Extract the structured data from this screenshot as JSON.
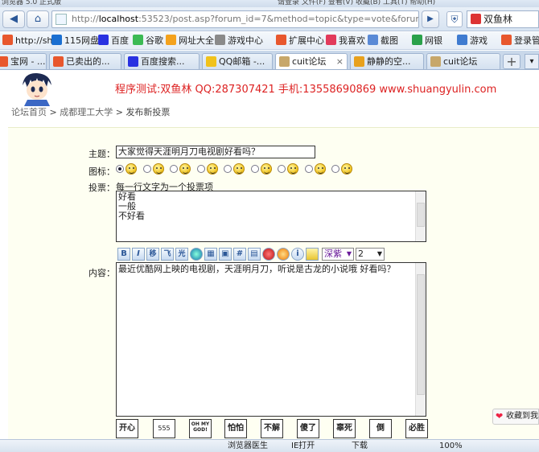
{
  "browser": {
    "title_left": "浏览器 5.0 正式版",
    "title_right": "请登录   文件(F)  查看(V)  收藏(B)  工具(T)  帮助(H)",
    "address_prefix": "http://",
    "address_host": "localhost",
    "address_rest": ":53523/post.asp?forum_id=7&method=topic&type=vote&forum_title",
    "search_value": "双鱼林"
  },
  "bookmarks": [
    {
      "label": "http://sh",
      "color": "#e8572d"
    },
    {
      "label": "115网盘",
      "color": "#1b6fd1"
    },
    {
      "label": "百度",
      "color": "#2932e1"
    },
    {
      "label": "谷歌",
      "color": "#3cba54"
    },
    {
      "label": "网址大全",
      "color": "#f4a21d"
    },
    {
      "label": "游戏中心",
      "color": "#8a8a8a"
    },
    {
      "label": "扩展中心",
      "color": "#e8572d"
    },
    {
      "label": "我喜欢",
      "color": "#e23a5b"
    },
    {
      "label": "截图",
      "color": "#5a8ad6"
    },
    {
      "label": "网银",
      "color": "#2aa14a"
    },
    {
      "label": "游戏",
      "color": "#3f7bd0"
    },
    {
      "label": "登录管",
      "color": "#e8572d"
    }
  ],
  "tabs": [
    {
      "label": "宝网 - ...",
      "color": "#e8572d"
    },
    {
      "label": "已卖出的...",
      "color": "#e8572d"
    },
    {
      "label": "百度搜索...",
      "color": "#2932e1"
    },
    {
      "label": "QQ邮箱 -...",
      "color": "#f1c21b"
    },
    {
      "label": "cuit论坛",
      "color": "#c7a76a"
    },
    {
      "label": "静静的空...",
      "color": "#e8a11d"
    },
    {
      "label": "cuit论坛",
      "color": "#c7a76a"
    }
  ],
  "page": {
    "headline": "程序测试:双鱼林 QQ:287307421 手机:13558690869 www.shuangyulin.com",
    "breadcrumb": [
      "论坛首页",
      "成都理工大学",
      "发布新投票"
    ],
    "subject_label": "主题：",
    "subject_value": "大家觉得天涯明月刀电视剧好看吗？",
    "icon_label": "图标：",
    "poll_label": "投票：",
    "poll_hint": "每一行文字为一个投票项",
    "poll_items": [
      "好看",
      "一般",
      "不好看"
    ],
    "content_label": "内容：",
    "content_value": "最近优酷网上映的电视剧，天涯明月刀，听说是古龙的小说哦 好看吗？",
    "color_select": "深紫",
    "size_select": "2",
    "toolbar_letters": [
      "B",
      "I",
      "移",
      "飞",
      "光"
    ],
    "emotes": [
      "开心",
      "555",
      "OH MY GOD!",
      "怕怕",
      "不解",
      "傻了",
      "辜死",
      "倒",
      "必胜"
    ],
    "favorite": "收藏到我"
  },
  "status": {
    "a": "浏览器医生",
    "b": "IE打开",
    "c": "下载",
    "zoom": "100%"
  }
}
